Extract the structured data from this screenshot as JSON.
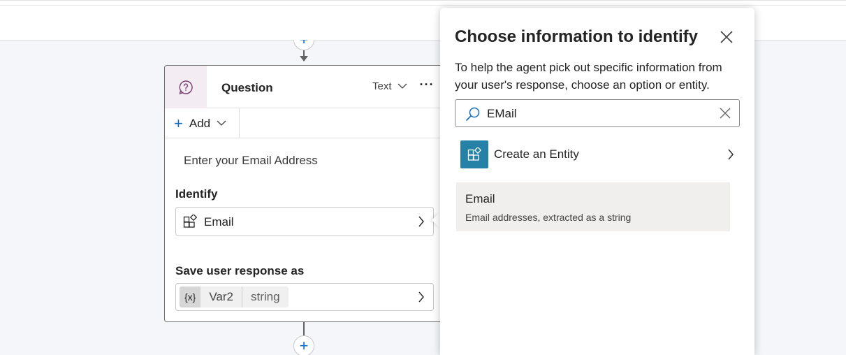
{
  "node": {
    "title": "Question",
    "response_type": "Text",
    "more_label": "···",
    "add_label": "Add",
    "prompt": "Enter your Email Address",
    "identify_label": "Identify",
    "identify_value": "Email",
    "save_label": "Save user response as",
    "variable": {
      "symbol": "{x}",
      "name": "Var2",
      "type": "string"
    }
  },
  "panel": {
    "title": "Choose information to identify",
    "description": "To help the agent pick out specific information from your user's response, choose an option or entity.",
    "search_value": "EMail",
    "create_entity_label": "Create an Entity",
    "results": [
      {
        "title": "Email",
        "description": "Email addresses, extracted as a string"
      }
    ]
  },
  "colors": {
    "accent": "#0f6cbd",
    "entity_tile": "#2581a6",
    "question_icon": "#7a3f72",
    "selected_result": "#f0efee"
  },
  "icons": {
    "question": "question-bubble-icon",
    "entity": "entity-blocks-icon",
    "search": "search-icon",
    "close": "close-icon",
    "chevron": "chevron-right-icon"
  }
}
